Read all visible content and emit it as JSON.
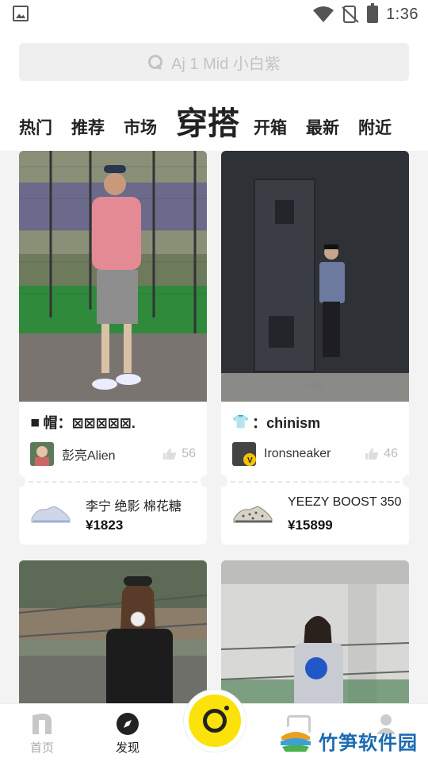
{
  "status_bar": {
    "time": "1:36"
  },
  "search": {
    "placeholder": "Aj 1 Mid 小白紫"
  },
  "tabs": [
    {
      "label": "热门",
      "active": false
    },
    {
      "label": "推荐",
      "active": false
    },
    {
      "label": "市场",
      "active": false
    },
    {
      "label": "穿搭",
      "active": true
    },
    {
      "label": "开箱",
      "active": false
    },
    {
      "label": "最新",
      "active": false
    },
    {
      "label": "附近",
      "active": false
    }
  ],
  "feed": {
    "cards": [
      {
        "title_emoji": "◾",
        "title": "帽：⊠⊠⊠⊠⊠.",
        "author": "彭亮Alien",
        "likes": "56",
        "product_name": "李宁 绝影 棉花糖",
        "product_price": "¥1823"
      },
      {
        "title_emoji": "👕",
        "title": "：chinism",
        "author": "Ironsneaker",
        "likes": "46",
        "product_name": "YEEZY BOOST 350",
        "product_price": "¥15899"
      }
    ]
  },
  "bottom_nav": {
    "home_label": "首页",
    "discover_label": "发现"
  },
  "watermark": {
    "text": "竹笋软件园"
  },
  "colors": {
    "accent_yellow": "#fbe20a",
    "watermark_blue": "#1a6bb0"
  }
}
